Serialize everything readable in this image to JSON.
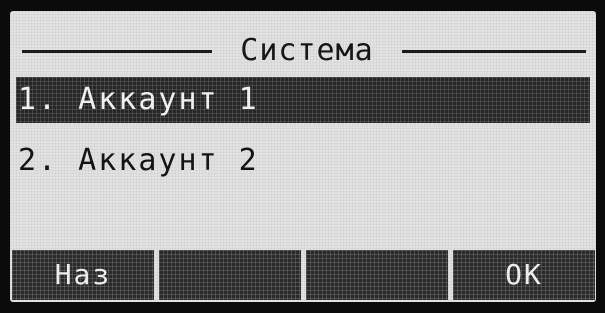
{
  "screen": {
    "title": "Система"
  },
  "menu": {
    "items": [
      {
        "label": "1. Аккаунт 1",
        "selected": true
      },
      {
        "label": "2. Аккаунт 2",
        "selected": false
      }
    ]
  },
  "softkeys": [
    {
      "label": "Наз"
    },
    {
      "label": ""
    },
    {
      "label": ""
    },
    {
      "label": "OK"
    }
  ],
  "colors": {
    "lcd_background": "#e2e2e2",
    "highlight": "#262626",
    "text_dark": "#141414",
    "text_light": "#f0f0f0",
    "bezel": "#0b0b0b"
  }
}
